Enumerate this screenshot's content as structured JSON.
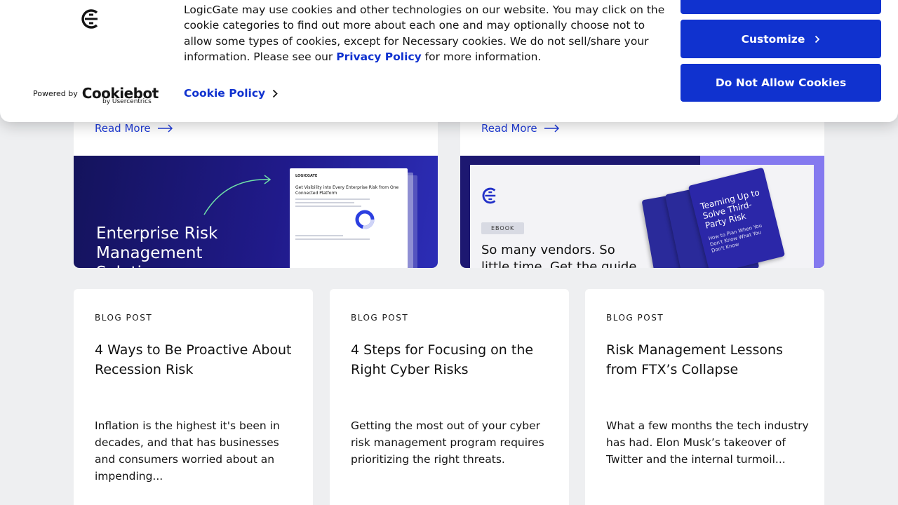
{
  "cookie_banner": {
    "message_part1": "LogicGate may use cookies and other technologies on our website. You may click on the cookie categories to find out more about each one and may optionally choose not to allow some types of cookies, except for Necessary cookies.  We do not sell/share your information. Please see our ",
    "privacy_link": "Privacy Policy",
    "message_part2": " for more information.",
    "powered_by": "Powered by",
    "cookiebot_logo_text": "Cookiebot",
    "usercentrics_text": "by Usercentrics",
    "cookie_policy_link": "Cookie Policy",
    "buttons": {
      "allow_label": "",
      "customize_label": "Customize",
      "deny_label": "Do Not Allow Cookies"
    },
    "colors": {
      "accent": "#1032cf"
    }
  },
  "featured": [
    {
      "read_more": "Read More",
      "image_title": "Enterprise Risk Management Solution",
      "image_doc": {
        "brand": "LOGICGATE",
        "heading": "Get Visibility into Every Enterprise Risk from One Connected Platform"
      }
    },
    {
      "read_more": "Read More",
      "image_tag": "EBOOK",
      "image_text": "So many vendors. So little time. Get the guide on",
      "book_title": "Teaming Up to Solve Third-Party Risk",
      "book_subtitle": "How to Plan When You Don't Know What You Don't Know"
    }
  ],
  "blog_cards": [
    {
      "tag": "BLOG POST",
      "title": "4 Ways to Be Proactive About Recession Risk",
      "excerpt": "Inflation is the highest it's been in decades, and that has businesses and consumers worried about an impending..."
    },
    {
      "tag": "BLOG POST",
      "title": "4 Steps for Focusing on the Right Cyber Risks",
      "excerpt": "Getting the most out of your cyber risk management program requires prioritizing the right threats."
    },
    {
      "tag": "BLOG POST",
      "title": "Risk Management Lessons from FTX’s Collapse",
      "excerpt": "What a few months the tech industry has had.  Elon Musk’s takeover of Twitter and the internal turmoil..."
    }
  ]
}
